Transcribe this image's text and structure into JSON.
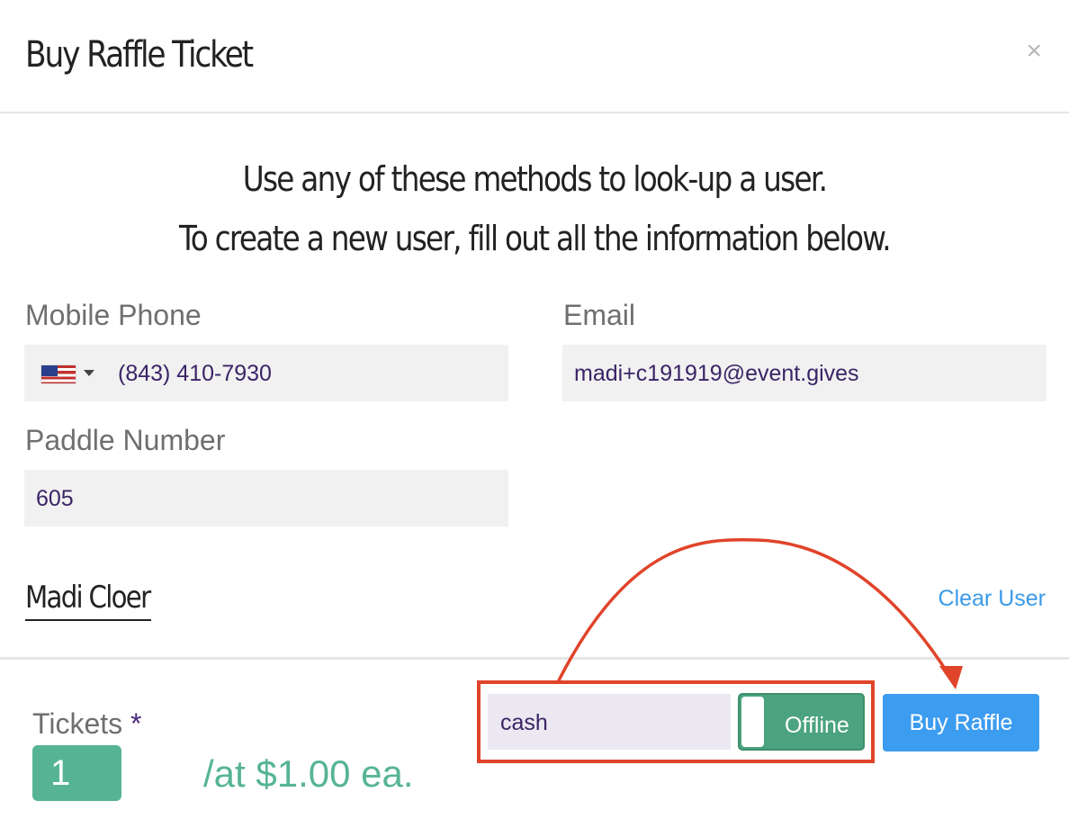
{
  "modal": {
    "title": "Buy Raffle Ticket",
    "close_label": "×"
  },
  "intro": {
    "line1": "Use any of these methods to look-up a user.",
    "line2": "To create a new user, fill out all the information below."
  },
  "form": {
    "phone": {
      "label": "Mobile Phone",
      "value": "(843) 410-7930",
      "country_icon": "us-flag-icon"
    },
    "email": {
      "label": "Email",
      "value": "madi+c191919@event.gives"
    },
    "paddle": {
      "label": "Paddle Number",
      "value": "605"
    }
  },
  "user": {
    "name": "Madi Cloer",
    "clear_label": "Clear User"
  },
  "purchase": {
    "tickets_label": "Tickets",
    "required_mark": "*",
    "quantity": "1",
    "price_text": "/at $1.00 ea.",
    "payment_method": "cash",
    "toggle_label": "Offline",
    "buy_label": "Buy Raffle"
  },
  "colors": {
    "accent_green": "#56b494",
    "toggle_green": "#4ba37f",
    "button_blue": "#3c9cf0",
    "link_blue": "#3b9ae8",
    "annotation_red": "#e0442a"
  }
}
